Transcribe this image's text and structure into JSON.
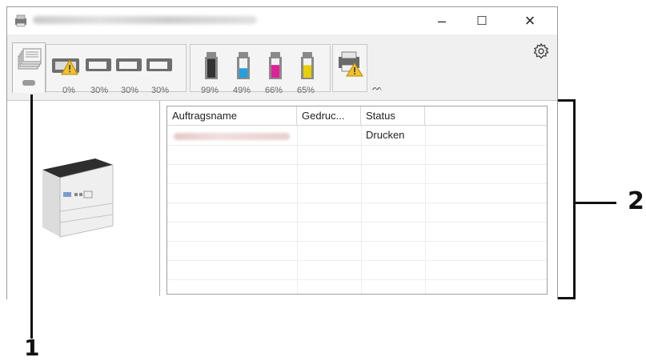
{
  "window": {
    "controls": {
      "minimize": "–",
      "maximize": "☐",
      "close": "×"
    }
  },
  "toolbar": {
    "paper_levels": [
      "0%",
      "30%",
      "30%",
      "30%"
    ],
    "toner_levels": [
      "99%",
      "49%",
      "66%",
      "65%"
    ],
    "toner_colors": [
      "#333333",
      "#22a0e0",
      "#e0209a",
      "#e8d000"
    ],
    "toner_fill": [
      0.99,
      0.49,
      0.66,
      0.65
    ],
    "collapse_glyph": "ᨓ"
  },
  "job_table": {
    "columns": [
      "Auftragsname",
      "Gedruc...",
      "Status"
    ],
    "rows": [
      {
        "status": "Drucken"
      }
    ]
  },
  "callouts": {
    "left": "1",
    "right": "2"
  },
  "colors": {
    "warning": "#f2c12e",
    "frame": "#9a9a9a"
  }
}
